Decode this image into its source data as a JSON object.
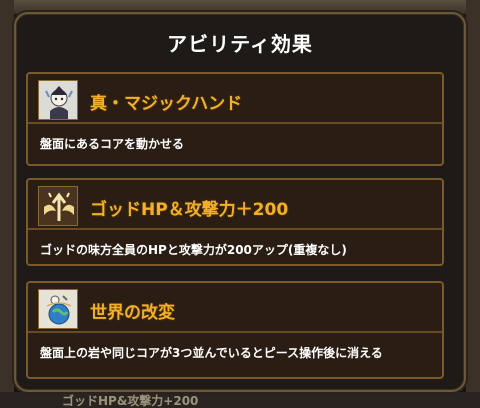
{
  "modal": {
    "title": "アビリティ効果"
  },
  "abilities": [
    {
      "name": "真・マジックハンド",
      "description": "盤面にあるコアを動かせる",
      "icon": "magic-hand-icon"
    },
    {
      "name": "ゴッドHP＆攻撃力＋200",
      "description": "ゴッドの味方全員のHPと攻撃力が200アップ(重複なし)",
      "icon": "stat-boost-icon"
    },
    {
      "name": "世界の改変",
      "description": "盤面上の岩や同じコアが3つ並んでいるとピース操作後に消える",
      "icon": "world-alter-icon"
    }
  ],
  "background": {
    "peek_text": "ゴッドHP&攻撃力+200"
  },
  "colors": {
    "title": "#ffffff",
    "ability_name": "#f2b028",
    "card_border": "#7a5a28"
  }
}
